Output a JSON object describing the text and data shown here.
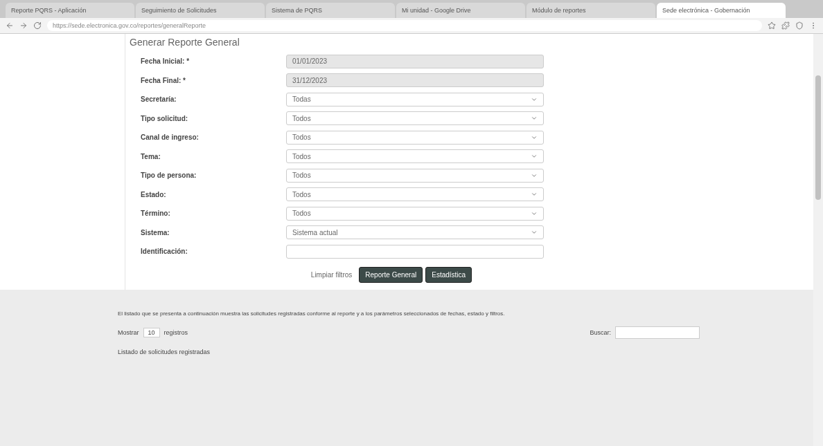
{
  "browser": {
    "tabs": [
      {
        "title": "Reporte PQRS - Aplicación",
        "selected": false
      },
      {
        "title": "Seguimiento de Solicitudes",
        "selected": false
      },
      {
        "title": "Sistema de PQRS",
        "selected": false
      },
      {
        "title": "Mi unidad - Google Drive",
        "selected": false
      },
      {
        "title": "Módulo de reportes",
        "selected": false
      },
      {
        "title": "Sede electrónica - Gobernación",
        "selected": true
      }
    ],
    "address": "https://sede.electronica.gov.co/reportes/generalReporte"
  },
  "form": {
    "title": "Generar Reporte General",
    "fields": [
      {
        "label": "Fecha Inicial: *",
        "kind": "date",
        "value": "01/01/2023"
      },
      {
        "label": "Fecha Final: *",
        "kind": "date",
        "value": "31/12/2023"
      },
      {
        "label": "Secretaría:",
        "kind": "select",
        "value": "Todas"
      },
      {
        "label": "Tipo solicitud:",
        "kind": "select",
        "value": "Todos"
      },
      {
        "label": "Canal de ingreso:",
        "kind": "select",
        "value": "Todos"
      },
      {
        "label": "Tema:",
        "kind": "select",
        "value": "Todos"
      },
      {
        "label": "Tipo de persona:",
        "kind": "select",
        "value": "Todos"
      },
      {
        "label": "Estado:",
        "kind": "select",
        "value": "Todos"
      },
      {
        "label": "Término:",
        "kind": "select",
        "value": "Todos"
      },
      {
        "label": "Sistema:",
        "kind": "select",
        "value": "Sistema actual"
      },
      {
        "label": "Identificación:",
        "kind": "text"
      }
    ],
    "buttons": [
      {
        "label": "Limpiar filtros",
        "kind": "link"
      },
      {
        "label": "Reporte General",
        "kind": "primary"
      },
      {
        "label": "Estadística",
        "kind": "primary"
      }
    ]
  },
  "note": "El listado que se presenta a continuación muestra las solicitudes registradas conforme al reporte y a los parámetros seleccionados de fechas, estado y filtros.",
  "table": {
    "show_label": "Mostrar",
    "page_size": "10",
    "records_label": "registros",
    "search_label": "Buscar:",
    "caption": "Listado de solicitudes registradas"
  }
}
